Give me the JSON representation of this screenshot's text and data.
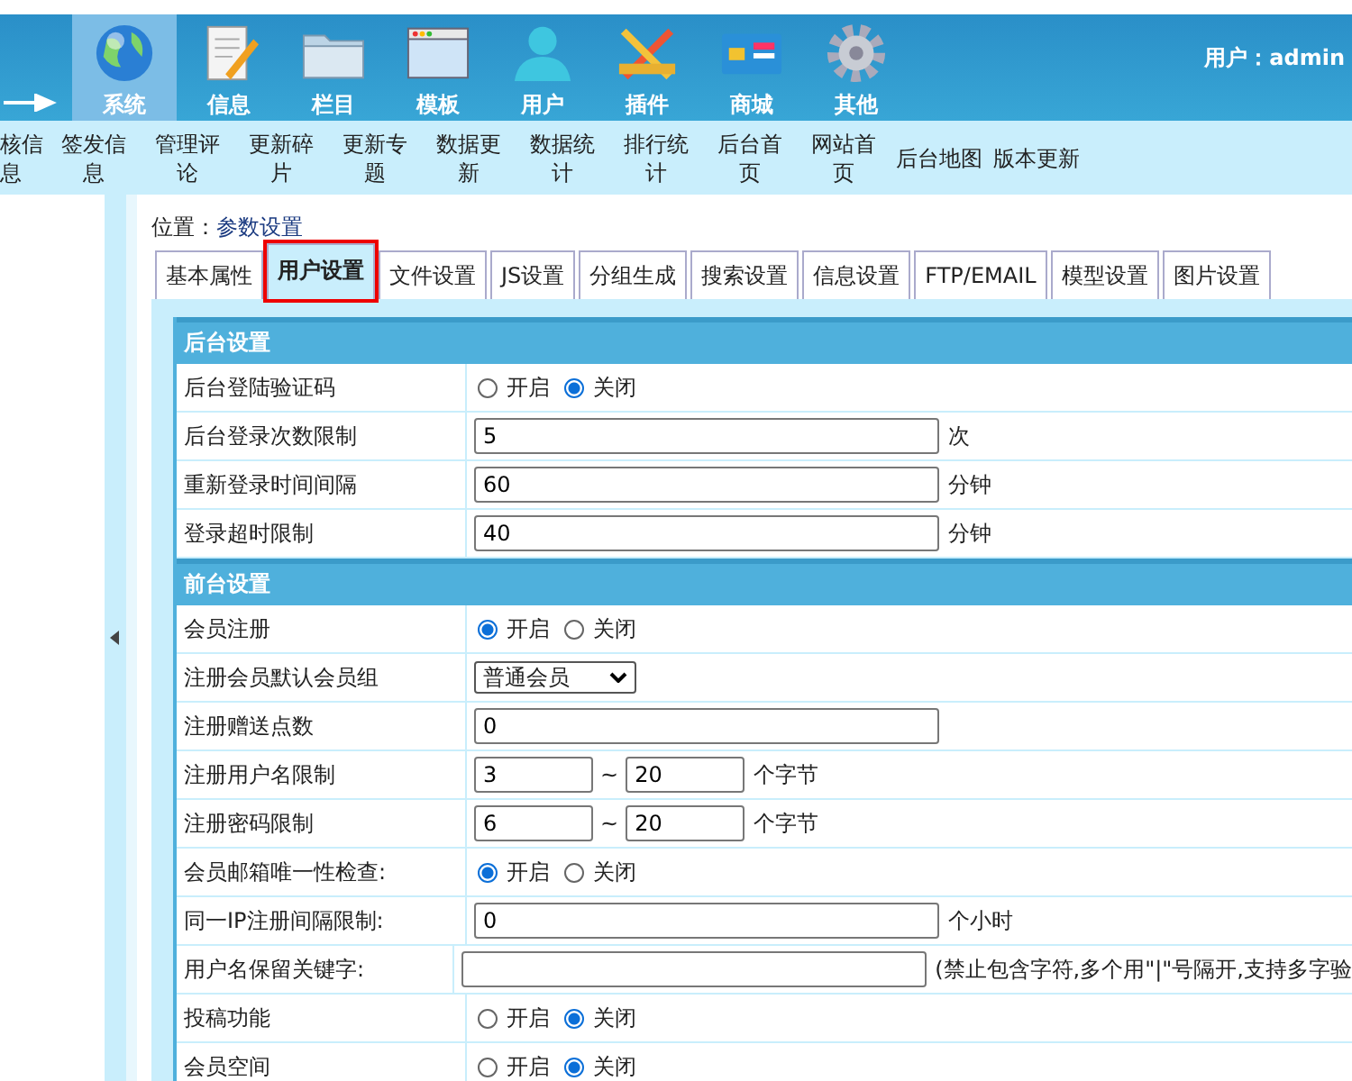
{
  "header": {
    "user_label": "用户：",
    "user_name": "admin"
  },
  "nav": [
    {
      "label": "系统",
      "selected": true
    },
    {
      "label": "信息",
      "selected": false
    },
    {
      "label": "栏目",
      "selected": false
    },
    {
      "label": "模板",
      "selected": false
    },
    {
      "label": "用户",
      "selected": false
    },
    {
      "label": "插件",
      "selected": false
    },
    {
      "label": "商城",
      "selected": false
    },
    {
      "label": "其他",
      "selected": false
    }
  ],
  "subnav": [
    "核信息",
    "签发信息",
    "管理评论",
    "更新碎片",
    "更新专题",
    "数据更新",
    "数据统计",
    "排行统计",
    "后台首页",
    "网站首页",
    "后台地图",
    "版本更新"
  ],
  "location": {
    "label": "位置：",
    "page": "参数设置"
  },
  "tabs": [
    {
      "label": "基本属性",
      "selected": false
    },
    {
      "label": "用户设置",
      "selected": true
    },
    {
      "label": "文件设置",
      "selected": false
    },
    {
      "label": "JS设置",
      "selected": false
    },
    {
      "label": "分组生成",
      "selected": false
    },
    {
      "label": "搜索设置",
      "selected": false
    },
    {
      "label": "信息设置",
      "selected": false
    },
    {
      "label": "FTP/EMAIL",
      "selected": false
    },
    {
      "label": "模型设置",
      "selected": false
    },
    {
      "label": "图片设置",
      "selected": false
    }
  ],
  "sections": [
    {
      "title": "后台设置",
      "rows": [
        {
          "kind": "radio",
          "label": "后台登陆验证码",
          "options": [
            {
              "label": "开启",
              "selected": false
            },
            {
              "label": "关闭",
              "selected": true
            }
          ]
        },
        {
          "kind": "text",
          "label": "后台登录次数限制",
          "value": "5",
          "suffix": "次"
        },
        {
          "kind": "text",
          "label": "重新登录时间间隔",
          "value": "60",
          "suffix": "分钟"
        },
        {
          "kind": "text",
          "label": "登录超时限制",
          "value": "40",
          "suffix": "分钟"
        }
      ]
    },
    {
      "title": "前台设置",
      "rows": [
        {
          "kind": "radio",
          "label": "会员注册",
          "options": [
            {
              "label": "开启",
              "selected": true
            },
            {
              "label": "关闭",
              "selected": false
            }
          ]
        },
        {
          "kind": "select",
          "label": "注册会员默认会员组",
          "value": "普通会员"
        },
        {
          "kind": "text",
          "label": "注册赠送点数",
          "value": "0"
        },
        {
          "kind": "range",
          "label": "注册用户名限制",
          "from": "3",
          "sep": "~",
          "to": "20",
          "suffix": "个字节"
        },
        {
          "kind": "range",
          "label": "注册密码限制",
          "from": "6",
          "sep": "~",
          "to": "20",
          "suffix": "个字节"
        },
        {
          "kind": "radio",
          "label": "会员邮箱唯一性检查:",
          "options": [
            {
              "label": "开启",
              "selected": true
            },
            {
              "label": "关闭",
              "selected": false
            }
          ]
        },
        {
          "kind": "text",
          "label": "同一IP注册间隔限制:",
          "value": "0",
          "suffix": "个小时"
        },
        {
          "kind": "text",
          "label": "用户名保留关键字:",
          "value": "",
          "suffix": "(禁止包含字符,多个用\"|\"号隔开,支持多字验"
        },
        {
          "kind": "radio",
          "label": "投稿功能",
          "options": [
            {
              "label": "开启",
              "selected": false
            },
            {
              "label": "关闭",
              "selected": true
            }
          ]
        },
        {
          "kind": "radio",
          "label": "会员空间",
          "options": [
            {
              "label": "开启",
              "selected": false
            },
            {
              "label": "关闭",
              "selected": true
            }
          ]
        }
      ]
    }
  ]
}
